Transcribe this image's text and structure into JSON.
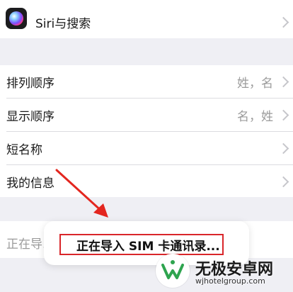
{
  "siri_row": {
    "label": "Siri与搜索",
    "icon": "siri-icon"
  },
  "sort_row": {
    "label": "排列顺序",
    "value": "姓，名"
  },
  "display_row": {
    "label": "显示顺序",
    "value": "名，姓"
  },
  "short_name_row": {
    "label": "短名称"
  },
  "my_info_row": {
    "label": "我的信息"
  },
  "import_row": {
    "label": "正在导..."
  },
  "toast": {
    "message": "正在导入 SIM 卡通讯录..."
  },
  "watermark": {
    "title": "无极安卓网",
    "subtitle": "wjhotelgroup.com"
  },
  "colors": {
    "highlight_border": "#d9262a",
    "arrow": "#e3261f",
    "background": "#efeff4"
  }
}
